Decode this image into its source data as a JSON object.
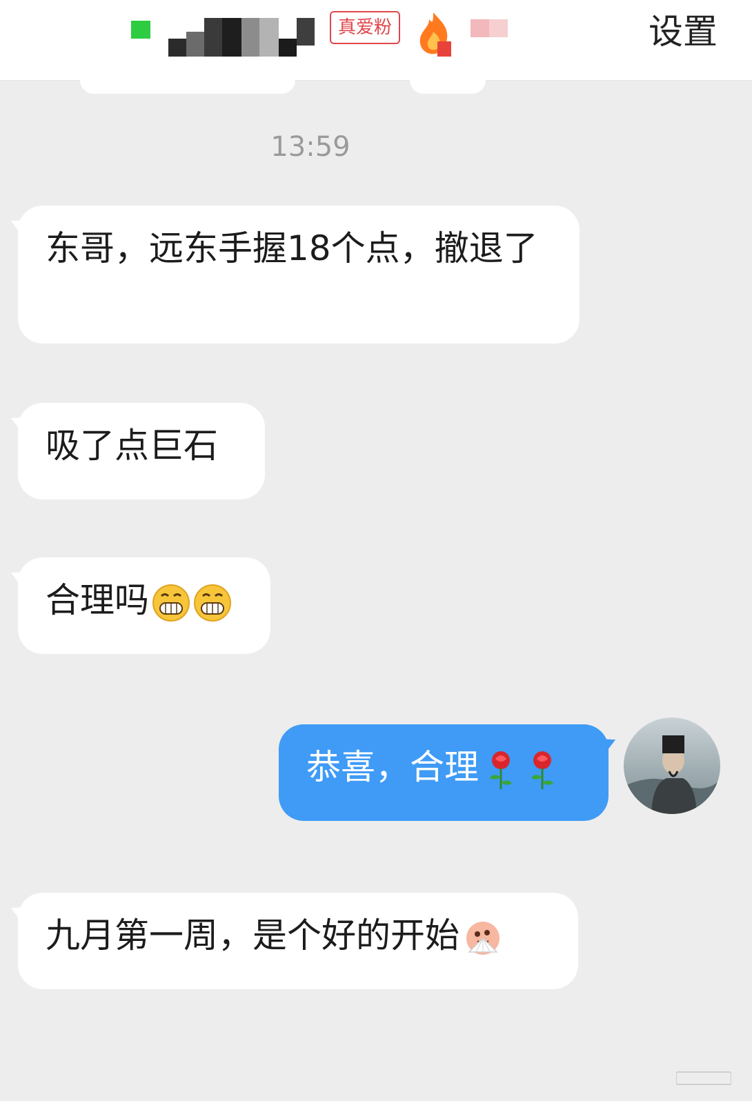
{
  "header": {
    "badge_label": "真爱粉",
    "settings_label": "设置"
  },
  "chat": {
    "timestamp": "13:59",
    "messages": [
      {
        "direction": "incoming",
        "text": "东哥，远东手握18个点，撤退了",
        "emojis": []
      },
      {
        "direction": "incoming",
        "text": "吸了点巨石",
        "emojis": []
      },
      {
        "direction": "incoming",
        "text": "合理吗",
        "emojis": [
          "grin-emoji",
          "grin-emoji"
        ]
      },
      {
        "direction": "outgoing",
        "text": "恭喜，合理",
        "emojis": [
          "rose-emoji",
          "rose-emoji"
        ]
      },
      {
        "direction": "incoming",
        "text": "九月第一周，是个好的开始",
        "emojis": [
          "fan-emoji"
        ]
      }
    ]
  },
  "colors": {
    "background": "#ededed",
    "incoming_bubble": "#ffffff",
    "outgoing_bubble": "#3f9bf6",
    "badge": "#e0464b",
    "online": "#2ecc40"
  }
}
